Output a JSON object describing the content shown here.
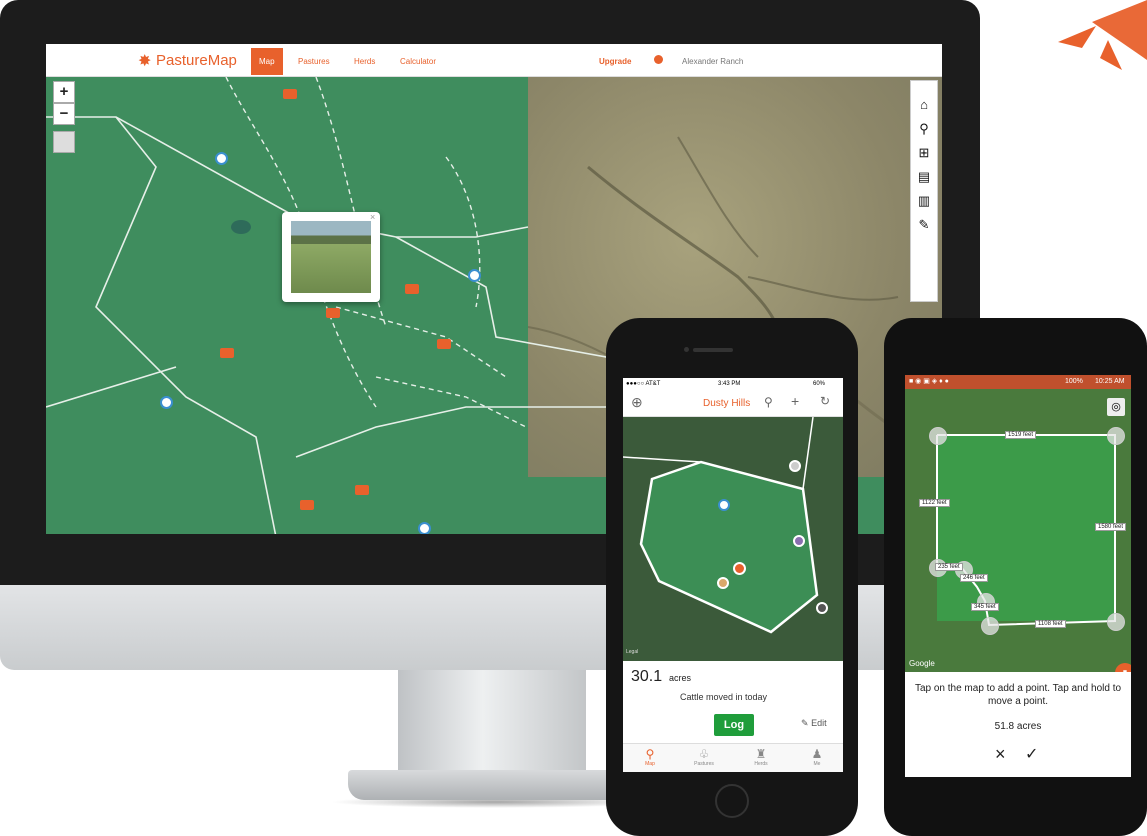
{
  "desktop": {
    "brand": "PastureMap",
    "nav": {
      "map": "Map",
      "pastures": "Pastures",
      "herds": "Herds",
      "calculator": "Calculator",
      "upgrade": "Upgrade",
      "ranch": "Alexander Ranch"
    },
    "zoom_in": "+",
    "zoom_out": "−"
  },
  "iphone": {
    "status": {
      "carrier": "●●●○○ AT&T",
      "time": "3:43 PM",
      "battery": "60%"
    },
    "title": "Dusty Hills",
    "acres_value": "30.1",
    "acres_unit": "acres",
    "herd_status": "Cattle moved in today",
    "log_label": "Log",
    "edit_label": "Edit",
    "tabs": [
      "Map",
      "Pastures",
      "Herds",
      "Me"
    ],
    "map_credit": "Legal"
  },
  "android": {
    "status": {
      "battery": "100%",
      "time": "10:25 AM"
    },
    "edge_labels": [
      "1519 feet",
      "1122 feet",
      "1580 feet",
      "235 feet",
      "246 feet",
      "345 feet",
      "1108 feet"
    ],
    "map_credit": "Google",
    "instructions": "Tap on the map to add a point. Tap and hold to move a point.",
    "area": "51.8 acres",
    "cancel_icon": "×",
    "confirm_icon": "✓"
  },
  "colors": {
    "brand_orange": "#e8612c",
    "log_green": "#1f9d3b",
    "pasture_green": "#3f8d5e"
  }
}
